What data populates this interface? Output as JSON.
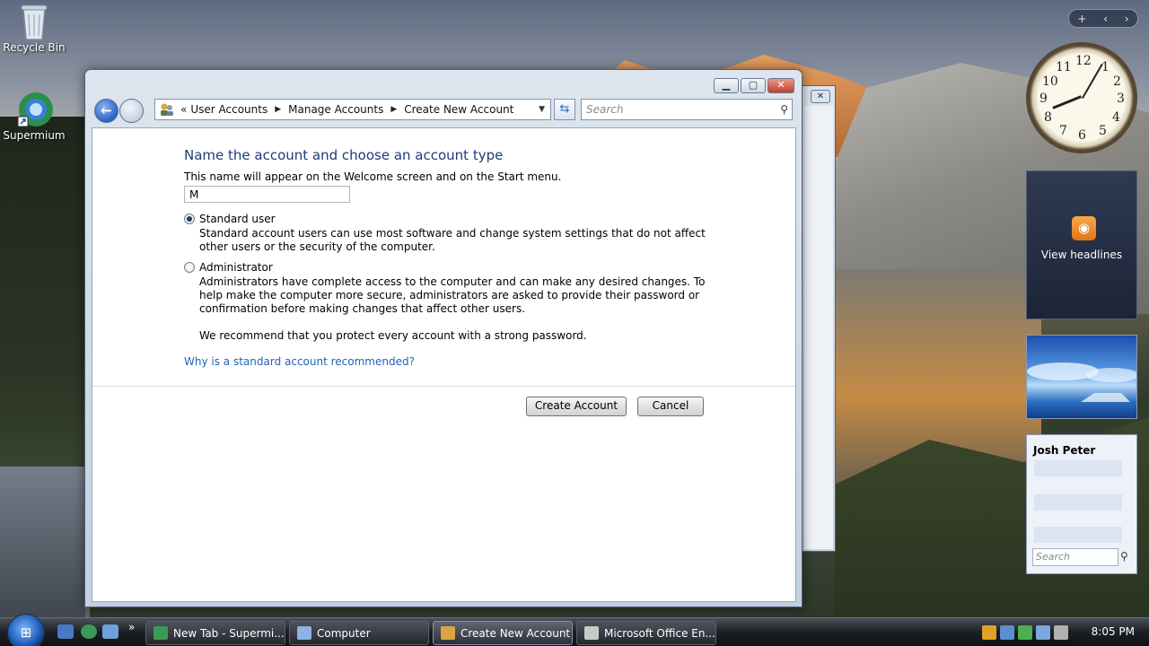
{
  "desktop": {
    "icons": [
      {
        "label": "Recycle Bin"
      },
      {
        "label": "Supermium"
      }
    ]
  },
  "window": {
    "title": "Create New Account",
    "breadcrumb": [
      "User Accounts",
      "Manage Accounts",
      "Create New Account"
    ],
    "search_placeholder": "Search",
    "heading": "Name the account and choose an account type",
    "description": "This name will appear on the Welcome screen and on the Start menu.",
    "account_name_value": "M",
    "options": [
      {
        "label": "Standard user",
        "selected": true,
        "description": "Standard account users can use most software and change system settings that do not affect other users or the security of the computer."
      },
      {
        "label": "Administrator",
        "selected": false,
        "description": "Administrators have complete access to the computer and can make any desired changes. To help make the computer more secure, administrators are asked to provide their password or confirmation before making changes that affect other users."
      }
    ],
    "recommendation": "We recommend that you protect every account with a strong password.",
    "help_link": "Why is a standard account recommended?",
    "buttons": {
      "create": "Create Account",
      "cancel": "Cancel"
    }
  },
  "gadgets": {
    "clock_numbers": [
      "12",
      "1",
      "2",
      "3",
      "4",
      "5",
      "6",
      "7",
      "8",
      "9",
      "10",
      "11"
    ],
    "clock_time": "8:05",
    "feed_label": "View headlines",
    "contact_name": "Josh Peter",
    "contact_search_placeholder": "Search",
    "sidebar_controls": [
      "+",
      "‹",
      "›"
    ]
  },
  "taskbar": {
    "tasks": [
      {
        "label": "New Tab - Supermi...",
        "active": false
      },
      {
        "label": "Computer",
        "active": false
      },
      {
        "label": "Create New Account",
        "active": true
      },
      {
        "label": "Microsoft Office En...",
        "active": false
      }
    ],
    "overflow": "»",
    "clock": "8:05 PM"
  },
  "colors": {
    "link": "#1f63b7",
    "heading": "#1e3b7a"
  }
}
